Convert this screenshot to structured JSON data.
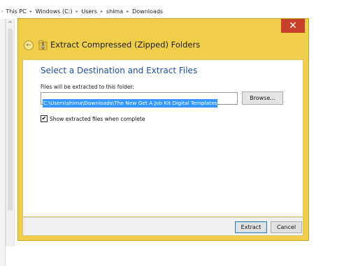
{
  "explorer": {
    "breadcrumb": [
      "This PC",
      "Windows (C:)",
      "Users",
      "shima",
      "Downloads"
    ],
    "lead_separator": "›",
    "separator": "▸",
    "scroll_up_glyph": "^"
  },
  "dialog": {
    "title": "Extract Compressed (Zipped) Folders",
    "close_glyph": "✕",
    "back_glyph": "←",
    "heading": "Select a Destination and Extract Files",
    "path_label": "Files will be extracted to this folder:",
    "path_value": "C:\\Users\\shima\\Downloads\\The New Get A Job Kit Digital Templates",
    "browse_label": "Browse...",
    "checkbox_label": "Show extracted files when complete",
    "checkbox_mark": "✔",
    "extract_label": "Extract",
    "cancel_label": "Cancel"
  },
  "colors": {
    "dialog_frame": "#efce4a",
    "close_button": "#c7402c",
    "heading": "#1f4f9c",
    "selection": "#3399ff"
  }
}
